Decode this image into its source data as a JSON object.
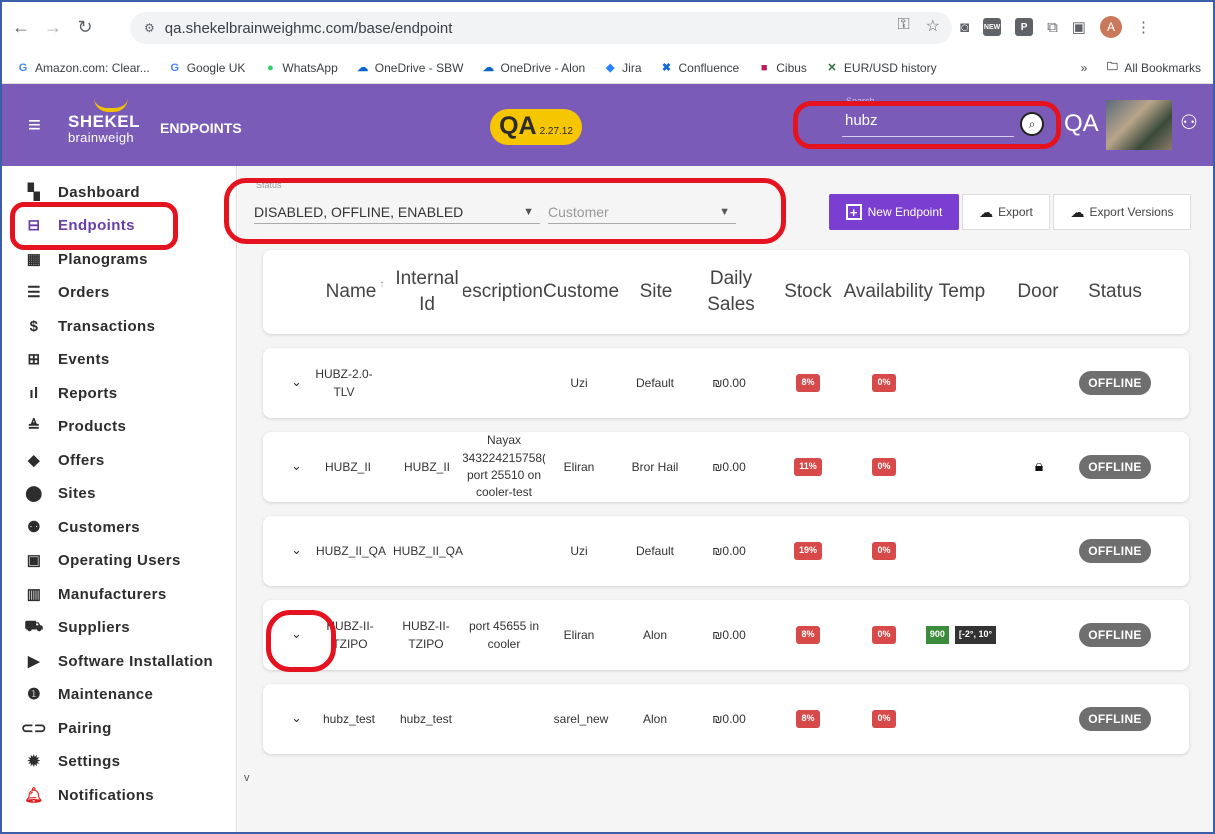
{
  "browser": {
    "url": "qa.shekelbrainweighmc.com/base/endpoint",
    "bookmarks": [
      "Amazon.com: Clear...",
      "Google UK",
      "WhatsApp",
      "OneDrive - SBW",
      "OneDrive - Alon",
      "Jira",
      "Confluence",
      "Cibus",
      "EUR/USD history"
    ],
    "more": "»",
    "all_bookmarks": "All Bookmarks",
    "avatar_letter": "A",
    "ext_p": "P"
  },
  "header": {
    "brand": "SHEKEL",
    "brand_sub": "brainweigh",
    "section": "ENDPOINTS",
    "env": "QA",
    "version": "2.27.12",
    "search_label": "Search",
    "search_value": "hubz",
    "env_right": "QA"
  },
  "sidebar": {
    "items": [
      {
        "label": "Dashboard",
        "icon": "dashboard-icon"
      },
      {
        "label": "Endpoints",
        "icon": "endpoints-icon"
      },
      {
        "label": "Planograms",
        "icon": "grid-icon"
      },
      {
        "label": "Orders",
        "icon": "list-icon"
      },
      {
        "label": "Transactions",
        "icon": "dollar-icon"
      },
      {
        "label": "Events",
        "icon": "events-icon"
      },
      {
        "label": "Reports",
        "icon": "bar-chart-icon"
      },
      {
        "label": "Products",
        "icon": "products-icon"
      },
      {
        "label": "Offers",
        "icon": "tag-icon"
      },
      {
        "label": "Sites",
        "icon": "pin-icon"
      },
      {
        "label": "Customers",
        "icon": "people-icon"
      },
      {
        "label": "Operating Users",
        "icon": "badge-icon"
      },
      {
        "label": "Manufacturers",
        "icon": "building-icon"
      },
      {
        "label": "Suppliers",
        "icon": "truck-icon"
      },
      {
        "label": "Software Installation",
        "icon": "play-icon"
      },
      {
        "label": "Maintenance",
        "icon": "info-icon"
      },
      {
        "label": "Pairing",
        "icon": "link-icon"
      },
      {
        "label": "Settings",
        "icon": "gear-icon"
      },
      {
        "label": "Notifications",
        "icon": "bell-icon"
      }
    ],
    "footer_v": "v"
  },
  "filters": {
    "status_label": "Status",
    "status_value": "DISABLED, OFFLINE, ENABLED",
    "customer_placeholder": "Customer"
  },
  "actions": {
    "new_endpoint": "New Endpoint",
    "export": "Export",
    "export_versions": "Export Versions"
  },
  "table": {
    "columns": [
      {
        "label": "Name",
        "extra": "↑"
      },
      {
        "label": "Internal\nId"
      },
      {
        "label": "Description"
      },
      {
        "label": "Customer"
      },
      {
        "label": "Site"
      },
      {
        "label": "Daily\nSales"
      },
      {
        "label": "Stock"
      },
      {
        "label": "Availability"
      },
      {
        "label": "Temp"
      },
      {
        "label": "Door"
      },
      {
        "label": "Status"
      }
    ],
    "rows": [
      {
        "name": "HUBZ-2.0-\nTLV",
        "internal_id": "",
        "description": "",
        "customer": "Uzi",
        "site": "Default",
        "daily_sales": "₪0.00",
        "stock": "8%",
        "availability": "0%",
        "temp": "",
        "temp_range": "",
        "door_locked": false,
        "status": "OFFLINE"
      },
      {
        "name": "HUBZ_II",
        "internal_id": "HUBZ_II",
        "description": "Nayax\n343224215758(\nport 25510 on\ncooler-test",
        "customer": "Eliran",
        "site": "Bror Hail",
        "daily_sales": "₪0.00",
        "stock": "11%",
        "availability": "0%",
        "temp": "",
        "temp_range": "",
        "door_locked": true,
        "status": "OFFLINE"
      },
      {
        "name": "HUBZ_II_QA",
        "internal_id": "HUBZ_II_QA",
        "description": "",
        "customer": "Uzi",
        "site": "Default",
        "daily_sales": "₪0.00",
        "stock": "19%",
        "availability": "0%",
        "temp": "",
        "temp_range": "",
        "door_locked": false,
        "status": "OFFLINE"
      },
      {
        "name": "HUBZ-II-\nTZIPO",
        "internal_id": "HUBZ-II-\nTZIPO",
        "description": "port 45655 in\ncooler",
        "customer": "Eliran",
        "site": "Alon",
        "daily_sales": "₪0.00",
        "stock": "8%",
        "availability": "0%",
        "temp": "900",
        "temp_range": "[-2°, 10°",
        "door_locked": false,
        "status": "OFFLINE"
      },
      {
        "name": "hubz_test",
        "internal_id": "hubz_test",
        "description": "",
        "customer": "sarel_new",
        "site": "Alon",
        "daily_sales": "₪0.00",
        "stock": "8%",
        "availability": "0%",
        "temp": "",
        "temp_range": "",
        "door_locked": false,
        "status": "OFFLINE"
      }
    ]
  },
  "colors": {
    "header_bg": "#7a5cb8",
    "accent": "#7a3fd0",
    "qa_pill": "#f6c600",
    "badge_red": "#d84a4a",
    "status_offline": "#6f6f6f",
    "annotation": "#e5131f"
  }
}
